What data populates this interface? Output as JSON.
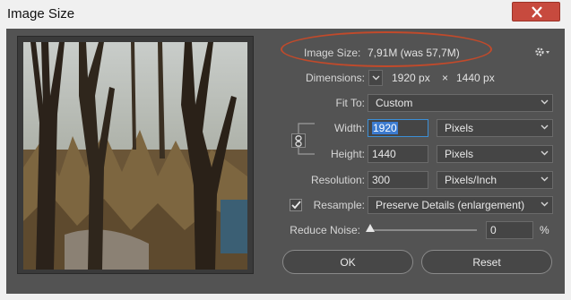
{
  "window": {
    "title": "Image Size"
  },
  "image_size": {
    "label": "Image Size:",
    "value": "7,91M (was 57,7M)"
  },
  "dimensions": {
    "label": "Dimensions:",
    "width": "1920 px",
    "times": "×",
    "height": "1440 px"
  },
  "fit_to": {
    "label": "Fit To:",
    "value": "Custom"
  },
  "width": {
    "label": "Width:",
    "value": "1920",
    "unit": "Pixels"
  },
  "height": {
    "label": "Height:",
    "value": "1440",
    "unit": "Pixels"
  },
  "resolution": {
    "label": "Resolution:",
    "value": "300",
    "unit": "Pixels/Inch"
  },
  "resample": {
    "label": "Resample:",
    "checked": true,
    "value": "Preserve Details (enlargement)"
  },
  "reduce_noise": {
    "label": "Reduce Noise:",
    "value": "0",
    "unit": "%",
    "level": 0
  },
  "buttons": {
    "ok": "OK",
    "reset": "Reset"
  },
  "colors": {
    "annotation": "#c14a2b",
    "accent": "#3c8fd6",
    "close": "#c74a3e"
  },
  "icons": [
    "close-icon",
    "gear-icon",
    "chevron-down-icon",
    "chain-link-icon",
    "checkbox-icon",
    "slider-triangle-icon"
  ]
}
